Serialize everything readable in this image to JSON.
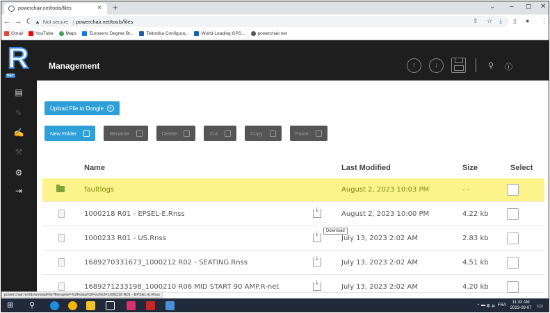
{
  "browser": {
    "tab_title": "powerchair.net/tools/files",
    "tab_close": "×",
    "new_tab": "+",
    "window_controls": [
      "⌄",
      "–",
      "◻",
      "✕"
    ],
    "nav": [
      "←",
      "→",
      "C"
    ],
    "not_secure": "Not secure",
    "url": "powerchair.net/tools/files",
    "bookmarks": [
      {
        "label": "Gmail",
        "color": "#ea4335"
      },
      {
        "label": "YouTube",
        "color": "#ff0000"
      },
      {
        "label": "Maps",
        "color": "#34a853"
      },
      {
        "label": "Eurosens Degree Bt...",
        "color": "#1a73e8"
      },
      {
        "label": "Teltonika Configura...",
        "color": "#1a5fb4"
      },
      {
        "label": "World-Leading GPS...",
        "color": "#1a5fb4"
      },
      {
        "label": "powerchair.net",
        "color": "#555555"
      }
    ]
  },
  "app": {
    "logo_letter": "R",
    "logo_badge": "NET",
    "page_title": "Management",
    "upload_label": "Upload File to Dongle",
    "upload_icon": "+",
    "toolbar": [
      {
        "label": "New Folder",
        "enabled": true
      },
      {
        "label": "Rename",
        "enabled": false
      },
      {
        "label": "Delete",
        "enabled": false
      },
      {
        "label": "Cut",
        "enabled": false
      },
      {
        "label": "Copy",
        "enabled": false
      },
      {
        "label": "Paste",
        "enabled": false
      }
    ],
    "columns": {
      "name": "Name",
      "modified": "Last Modified",
      "size": "Size",
      "select": "Select"
    },
    "rows": [
      {
        "type": "folder",
        "name": "faultlogs",
        "modified": "August 2, 2023 10:03 PM",
        "size": "- -",
        "highlighted": true
      },
      {
        "type": "file",
        "name": "1000218 R01 - EPSEL-E.Rnss",
        "modified": "August 2, 2023 10:00 PM",
        "size": "4.22 kb",
        "highlighted": false
      },
      {
        "type": "file",
        "name": "1000233 R01 - US.Rnss",
        "modified": "July 13, 2023 2:02 AM",
        "size": "2.83 kb",
        "highlighted": false
      },
      {
        "type": "file",
        "name": "1689270331673_1000212 R02 - SEATING.Rnss",
        "modified": "July 13, 2023 2:02 AM",
        "size": "4.51 kb",
        "highlighted": false
      },
      {
        "type": "file",
        "name": "1689271233198_1000210 R06 MID START 90 AMP.R-net",
        "modified": "July 13, 2023 2:02 AM",
        "size": "4.20 kb",
        "highlighted": false
      }
    ],
    "tooltip": "Download",
    "status_url": "powerchair.net/downloadFile?filename=%2Fdata%2Fext%2F1000218 R01 - EPSEL-E.Rnss"
  },
  "taskbar": {
    "lang": "FRA",
    "time": "11:33 AM",
    "date": "2023-09-07"
  },
  "colors": {
    "accent": "#2f9fd8",
    "highlight": "#fcf48a",
    "folder": "#7ea33a"
  }
}
